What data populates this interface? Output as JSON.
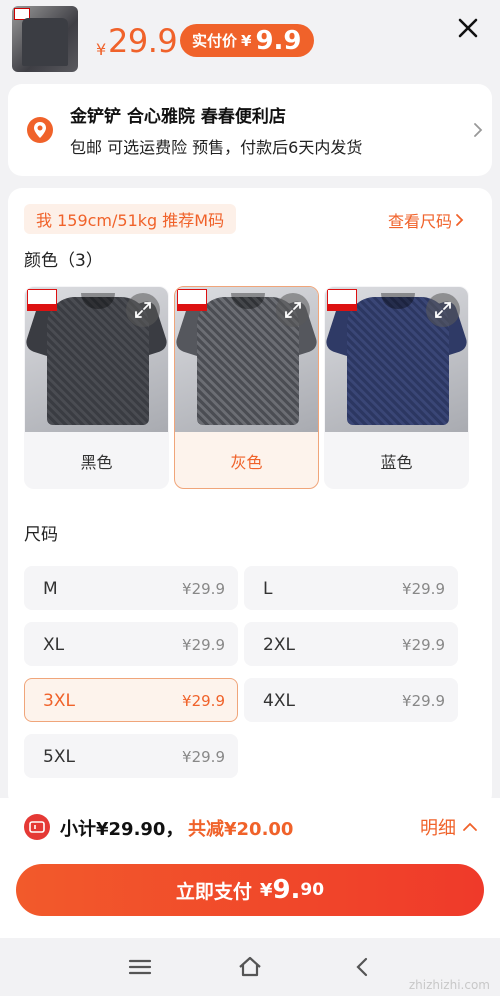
{
  "header": {
    "yen": "¥",
    "price": "29.9",
    "actual_label": "实付价",
    "actual_yen": "¥",
    "actual_value": "9.9"
  },
  "shop": {
    "name": "金铲铲 合心雅院 春春便利店",
    "subtitle": "包邮 可选运费险 预售，付款后6天内发货"
  },
  "recommend": {
    "text": "我 159cm/51kg 推荐M码",
    "size_chart_label": "查看尺码"
  },
  "color_section": {
    "title": "颜色（3）",
    "options": [
      {
        "name": "黑色",
        "shirt_color": "#3a3c42",
        "bg": "#c9cbd0",
        "selected": false
      },
      {
        "name": "灰色",
        "shirt_color": "#55575d",
        "bg": "#c9cbd0",
        "selected": true
      },
      {
        "name": "蓝色",
        "shirt_color": "#2f3a66",
        "bg": "#c9cbd0",
        "selected": false
      }
    ]
  },
  "size_section": {
    "title": "尺码",
    "options": [
      {
        "size": "M",
        "price": "¥29.9",
        "selected": false
      },
      {
        "size": "L",
        "price": "¥29.9",
        "selected": false
      },
      {
        "size": "XL",
        "price": "¥29.9",
        "selected": false
      },
      {
        "size": "2XL",
        "price": "¥29.9",
        "selected": false
      },
      {
        "size": "3XL",
        "price": "¥29.9",
        "selected": true
      },
      {
        "size": "4XL",
        "price": "¥29.9",
        "selected": false
      },
      {
        "size": "5XL",
        "price": "¥29.9",
        "selected": false
      }
    ]
  },
  "bottom": {
    "subtotal": "小计¥29.90，",
    "reduce": "共减¥20.00",
    "detail": "明细",
    "pay_label": "立即支付",
    "pay_yen": "¥",
    "pay_int": "9.",
    "pay_dec": "90"
  },
  "colors": {
    "accent": "#f0622a",
    "pay_gradient_end": "#ef3a2a",
    "coupon_red": "#e53935"
  },
  "watermark": "zhizhizhi.com"
}
